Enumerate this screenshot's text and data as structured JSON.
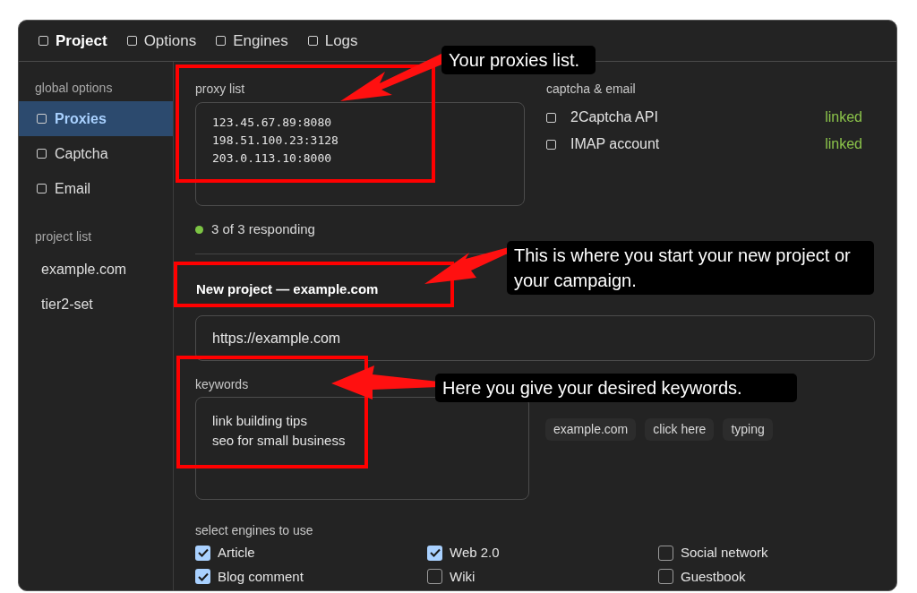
{
  "tabs": [
    {
      "label": "Project",
      "selected": true
    },
    {
      "label": "Options",
      "selected": false
    },
    {
      "label": "Engines",
      "selected": false
    },
    {
      "label": "Logs",
      "selected": false
    }
  ],
  "sidebar": {
    "sections": [
      {
        "heading": "global options",
        "items": [
          {
            "label": "Proxies",
            "kind": "option",
            "selected": true
          },
          {
            "label": "Captcha",
            "kind": "option",
            "selected": false
          },
          {
            "label": "Email",
            "kind": "option",
            "selected": false
          }
        ]
      },
      {
        "heading": "project list",
        "items": [
          {
            "label": "example.com",
            "kind": "project",
            "selected": false
          },
          {
            "label": "tier2-set",
            "kind": "project",
            "selected": false
          }
        ]
      }
    ]
  },
  "proxy_list": {
    "label": "proxy list",
    "lines": [
      "123.45.67.89:8080",
      "198.51.100.23:3128",
      "203.0.113.10:8000"
    ],
    "status": "3 of 3 responding"
  },
  "captcha_email": {
    "heading": "captcha & email",
    "rows": [
      {
        "name": "2Captcha API",
        "status": "linked"
      },
      {
        "name": "IMAP account",
        "status": "linked"
      }
    ]
  },
  "project": {
    "title": "New project — example.com",
    "url": "https://example.com",
    "keywords_label": "keywords",
    "keywords": [
      "link building tips",
      "seo for small business"
    ],
    "chips": [
      "example.com",
      "click here",
      "typing"
    ]
  },
  "engines": {
    "heading": "select engines to use",
    "items": [
      {
        "label": "Article",
        "checked": true
      },
      {
        "label": "Web 2.0",
        "checked": true
      },
      {
        "label": "Social network",
        "checked": false
      },
      {
        "label": "Blog comment",
        "checked": true
      },
      {
        "label": "Wiki",
        "checked": false
      },
      {
        "label": "Guestbook",
        "checked": false
      }
    ]
  },
  "annotations": [
    {
      "text": "Your proxies list."
    },
    {
      "text": "This is where you start your new project or your campaign."
    },
    {
      "text": "Here you give your desired keywords."
    }
  ]
}
